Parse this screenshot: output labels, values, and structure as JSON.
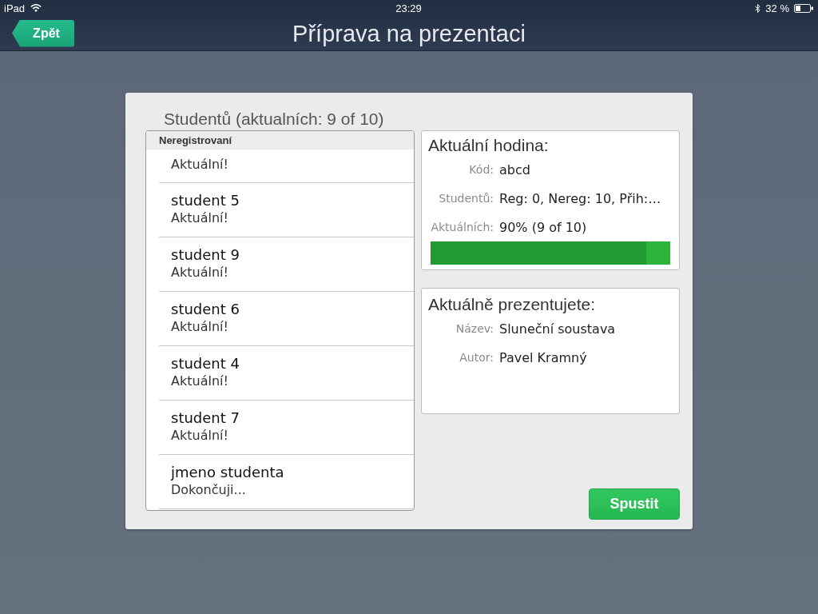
{
  "status_bar": {
    "device": "iPad",
    "time": "23:29",
    "battery": "32 %"
  },
  "nav_bar": {
    "back_button": "Zpět",
    "title": "Příprava na prezentaci"
  },
  "students": {
    "title": "Studentů (aktualních: 9 of 10)",
    "section_header": "Neregistrovaní",
    "rows": [
      {
        "status": "Aktuální!"
      },
      {
        "name": "student 5",
        "status": "Aktuální!"
      },
      {
        "name": "student 9",
        "status": "Aktuální!"
      },
      {
        "name": "student 6",
        "status": "Aktuální!"
      },
      {
        "name": "student 4",
        "status": "Aktuální!"
      },
      {
        "name": "student 7",
        "status": "Aktuální!"
      },
      {
        "name": "jmeno studenta",
        "status": "Dokončuji..."
      }
    ]
  },
  "current_lesson": {
    "title": "Aktuální hodina:",
    "fields": [
      {
        "label": "Kód:",
        "value": "abcd"
      },
      {
        "label": "Studentů:",
        "value": "Reg: 0, Nereg: 10, Přih:…"
      },
      {
        "label": "Aktuálních:",
        "value": "90% (9 of 10)"
      }
    ],
    "progress": {
      "level": 0.9
    }
  },
  "presenting": {
    "title": "Aktuálně prezentujete:",
    "fields": [
      {
        "label": "Název:",
        "value": "Sluneční soustava"
      },
      {
        "label": "Autor:",
        "value": "Pavel Kramný"
      }
    ]
  },
  "start_button": "Spustit"
}
